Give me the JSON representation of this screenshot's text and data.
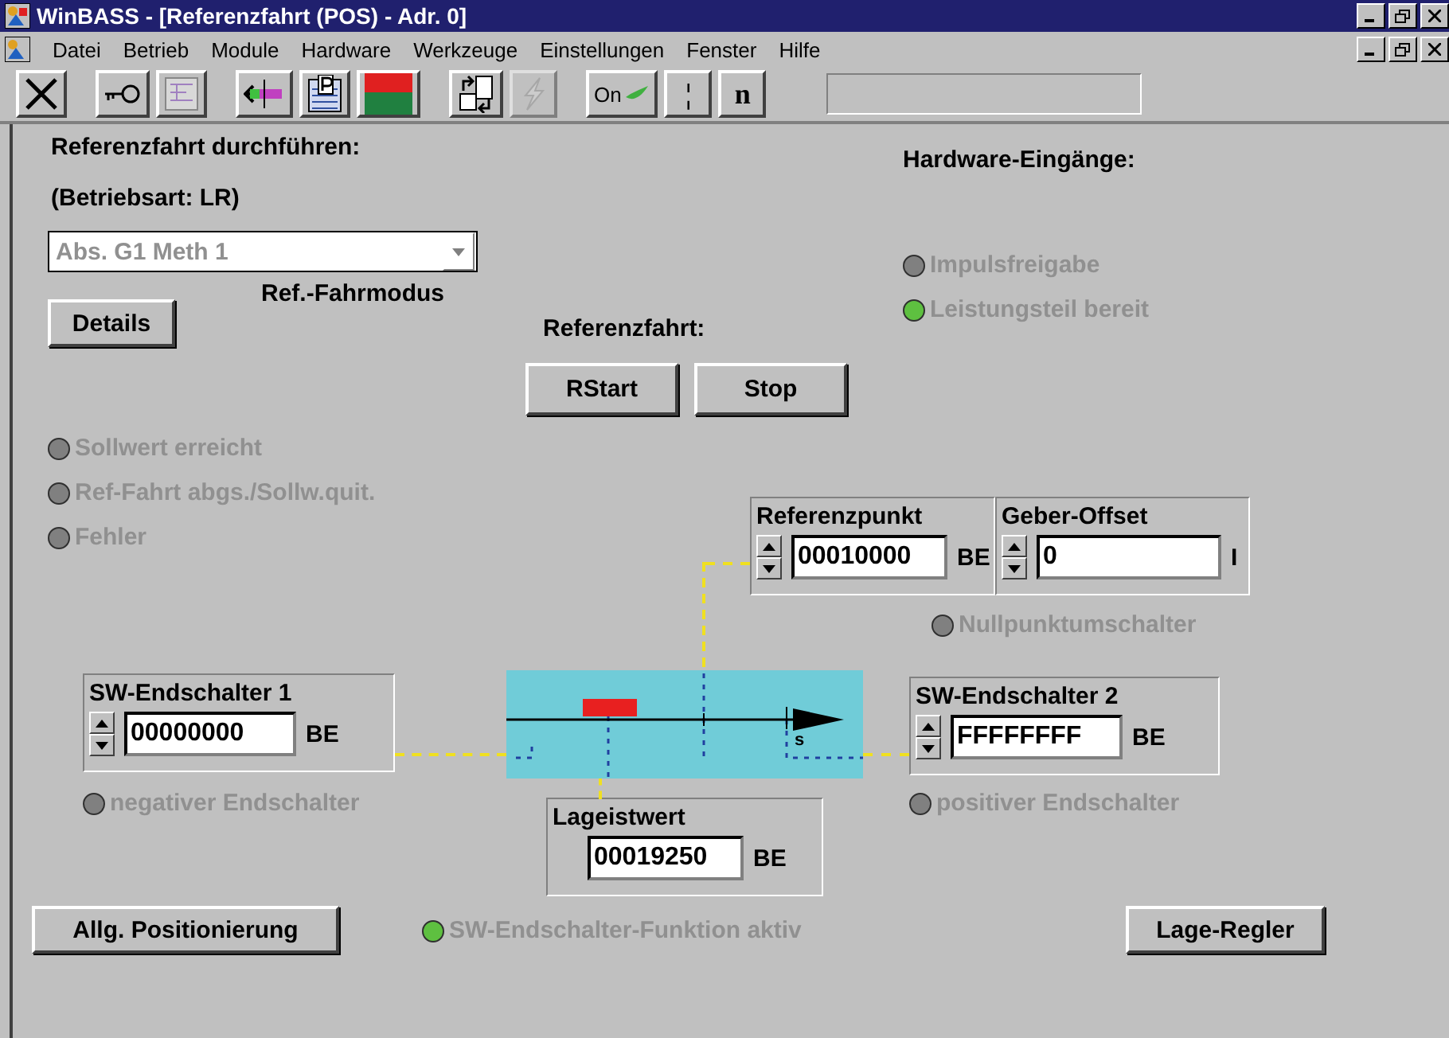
{
  "window": {
    "title": "WinBASS - [Referenzfahrt (POS) - Adr. 0]"
  },
  "menu": [
    "Datei",
    "Betrieb",
    "Module",
    "Hardware",
    "Werkzeuge",
    "Einstellungen",
    "Fenster",
    "Hilfe"
  ],
  "toolbar": [
    {
      "kind": "close"
    },
    {
      "kind": "key"
    },
    {
      "kind": "ladder"
    },
    {
      "kind": "arrows"
    },
    {
      "kind": "parameter"
    },
    {
      "kind": "colors"
    },
    {
      "kind": "transfer"
    },
    {
      "kind": "lightning",
      "disabled": true
    },
    {
      "kind": "on",
      "label": "On"
    },
    {
      "kind": "text",
      "label": "¦"
    },
    {
      "kind": "text",
      "label": "n"
    }
  ],
  "heading": "Referenzfahrt durchführen:",
  "mode_label": "(Betriebsart: LR)",
  "ref_mode": {
    "value": "Abs. G1 Meth 1",
    "caption": "Ref.-Fahrmodus",
    "disabled": true
  },
  "details_button": "Details",
  "ref_run": {
    "label": "Referenzfahrt:",
    "buttons": [
      "RStart",
      "Stop"
    ]
  },
  "hardware_inputs": {
    "title": "Hardware-Eingänge:",
    "leds": [
      {
        "label": "Impulsfreigabe",
        "on": false
      },
      {
        "label": "Leistungsteil bereit",
        "on": true
      }
    ]
  },
  "status_leds": [
    {
      "label": "Sollwert erreicht",
      "on": false
    },
    {
      "label": "Ref-Fahrt abgs./Sollw.quit.",
      "on": false
    },
    {
      "label": "Fehler",
      "on": false
    }
  ],
  "reference_point": {
    "title": "Referenzpunkt",
    "value": "00010000",
    "unit": "BE"
  },
  "encoder_offset": {
    "title": "Geber-Offset",
    "value": "0",
    "unit": "I"
  },
  "zero_switch": {
    "label": "Nullpunktumschalter",
    "on": false
  },
  "sw_limit_1": {
    "title": "SW-Endschalter 1",
    "value": "00000000",
    "unit": "BE",
    "led": {
      "label": "negativer Endschalter",
      "on": false
    }
  },
  "sw_limit_2": {
    "title": "SW-Endschalter 2",
    "value": "FFFFFFFF",
    "unit": "BE",
    "led": {
      "label": "positiver Endschalter",
      "on": false
    }
  },
  "axis": {
    "axis_label": "s"
  },
  "actual_position": {
    "title": "Lageistwert",
    "value": "00019250",
    "unit": "BE"
  },
  "bottom": {
    "left_button": "Allg. Positionierung",
    "led": {
      "label": "SW-Endschalter-Funktion aktiv",
      "on": true
    },
    "right_button": "Lage-Regler"
  }
}
